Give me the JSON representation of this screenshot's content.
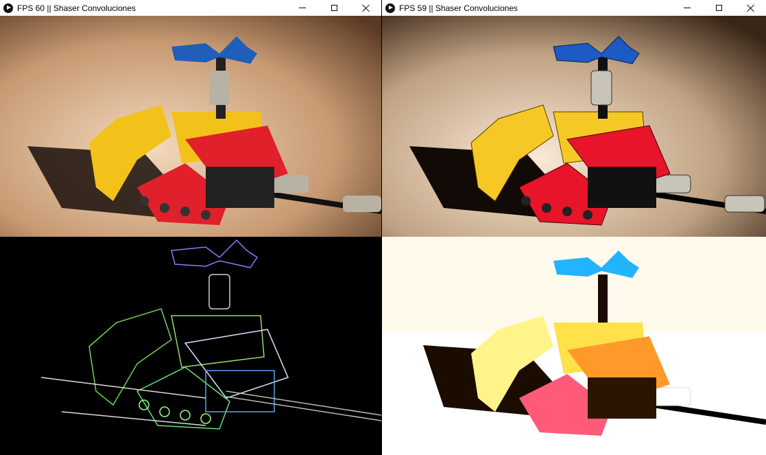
{
  "windows": [
    {
      "title": "FPS 60 || Shaser Convoluciones",
      "filter": "original",
      "colors": {
        "background": "#c79a72",
        "shadow": "#1a0f0a"
      }
    },
    {
      "title": "FPS 59 || Shaser Convoluciones",
      "filter": "sharpen",
      "colors": {
        "background": "#bfa283",
        "shadow": "#120a06"
      }
    }
  ],
  "quadrants": {
    "bottom_left": {
      "filter": "edge-detect",
      "colors": {
        "background": "#000000"
      }
    },
    "bottom_right": {
      "filter": "brighten",
      "colors": {
        "background": "#ffffff"
      }
    }
  },
  "icons": {
    "app": "app-icon",
    "minimize": "minimize-icon",
    "maximize": "maximize-icon",
    "close": "close-icon"
  },
  "colors": {
    "lego_red": "#e0202a",
    "lego_yellow": "#f2c21a",
    "lego_blue": "#1f5fb8",
    "lego_gray": "#b8b2a5"
  }
}
